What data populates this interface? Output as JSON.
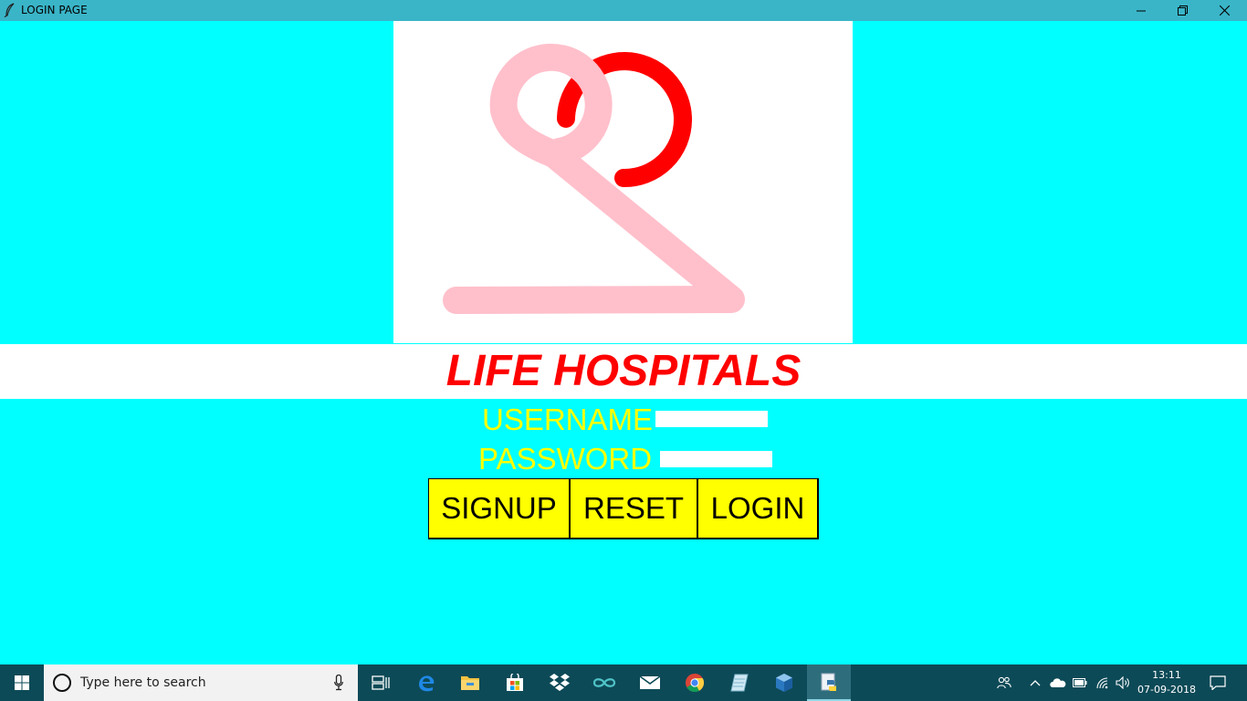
{
  "window": {
    "title": "LOGIN PAGE"
  },
  "app": {
    "hospital_name": "LIFE HOSPITALS",
    "username_label": "USERNAME",
    "password_label": "PASSWORD",
    "username_value": "",
    "password_value": "",
    "buttons": {
      "signup": "SIGNUP",
      "reset": "RESET",
      "login": "LOGIN"
    }
  },
  "colors": {
    "background": "#00ffff",
    "title_text": "#ff0000",
    "label_text": "#ffff00",
    "button_bg": "#ffff00",
    "logo_pink": "#ffc0cb",
    "logo_red": "#ff0000",
    "taskbar": "#0d4a57"
  },
  "taskbar": {
    "search_placeholder": "Type here to search",
    "pinned_icons": [
      "task-view-icon",
      "edge-icon",
      "file-explorer-icon",
      "store-icon",
      "dropbox-icon",
      "arduino-icon",
      "mail-icon",
      "chrome-icon",
      "notepad-icon",
      "virtualbox-icon",
      "python-icon"
    ],
    "tray_icons": [
      "people-icon",
      "chevron-up-icon",
      "onedrive-icon",
      "battery-icon",
      "wifi-icon",
      "volume-icon",
      "action-center-icon"
    ],
    "time": "13:11",
    "date": "07-09-2018"
  }
}
